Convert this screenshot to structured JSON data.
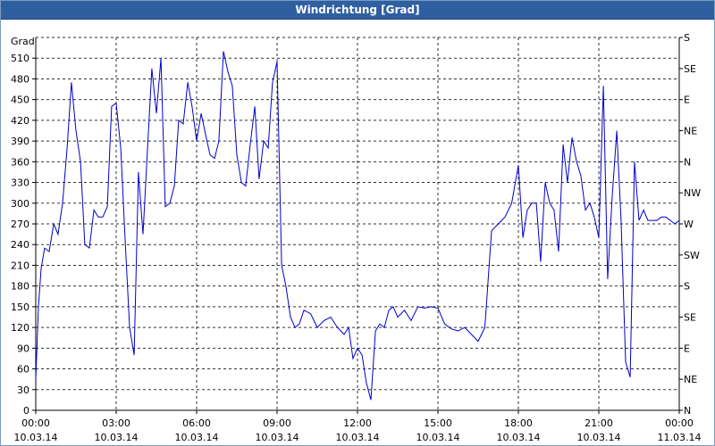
{
  "window": {
    "title": "Windrichtung [Grad]"
  },
  "chart_data": {
    "type": "line",
    "title": "Windrichtung [Grad]",
    "ylabel": "Grad",
    "ylim": [
      0,
      540
    ],
    "y_ticks": [
      0,
      30,
      60,
      90,
      120,
      150,
      180,
      210,
      240,
      270,
      300,
      330,
      360,
      390,
      420,
      450,
      480,
      510
    ],
    "y2_labels": [
      "N",
      "NE",
      "E",
      "SE",
      "S",
      "SW",
      "W",
      "NW",
      "N",
      "NE",
      "E",
      "SE",
      "S"
    ],
    "x_range_hours": [
      0,
      24
    ],
    "x_ticks": [
      {
        "t": 0,
        "time": "00:00",
        "date": "10.03.14"
      },
      {
        "t": 3,
        "time": "03:00",
        "date": "10.03.14"
      },
      {
        "t": 6,
        "time": "06:00",
        "date": "10.03.14"
      },
      {
        "t": 9,
        "time": "09:00",
        "date": "10.03.14"
      },
      {
        "t": 12,
        "time": "12:00",
        "date": "10.03.14"
      },
      {
        "t": 15,
        "time": "15:00",
        "date": "10.03.14"
      },
      {
        "t": 18,
        "time": "18:00",
        "date": "10.03.14"
      },
      {
        "t": 21,
        "time": "21:00",
        "date": "10.03.14"
      },
      {
        "t": 24,
        "time": "00:00",
        "date": "11.03.14"
      }
    ],
    "grid": true,
    "colors": {
      "series": "#0000cc",
      "titlebar": "#2f5fa0"
    },
    "series": [
      {
        "x": [
          0.0,
          0.1,
          0.2,
          0.33,
          0.5,
          0.67,
          0.83,
          1.0,
          1.17,
          1.33,
          1.5,
          1.67,
          1.83,
          2.0,
          2.17,
          2.33,
          2.5,
          2.67,
          2.83,
          3.0,
          3.17,
          3.33,
          3.5,
          3.67,
          3.83,
          4.0,
          4.17,
          4.33,
          4.5,
          4.67,
          4.83,
          5.0,
          5.17,
          5.33,
          5.5,
          5.67,
          5.83,
          6.0,
          6.17,
          6.33,
          6.5,
          6.67,
          6.83,
          7.0,
          7.17,
          7.33,
          7.5,
          7.67,
          7.83,
          8.0,
          8.17,
          8.33,
          8.5,
          8.67,
          8.83,
          9.0,
          9.17,
          9.33,
          9.5,
          9.67,
          9.83,
          10.0,
          10.25,
          10.5,
          10.75,
          11.0,
          11.25,
          11.5,
          11.67,
          11.83,
          12.0,
          12.17,
          12.33,
          12.5,
          12.67,
          12.83,
          13.0,
          13.17,
          13.33,
          13.5,
          13.75,
          14.0,
          14.25,
          14.5,
          14.75,
          15.0,
          15.25,
          15.5,
          15.75,
          16.0,
          16.25,
          16.5,
          16.75,
          17.0,
          17.25,
          17.5,
          17.75,
          18.0,
          18.17,
          18.33,
          18.5,
          18.67,
          18.83,
          19.0,
          19.17,
          19.33,
          19.5,
          19.67,
          19.83,
          20.0,
          20.17,
          20.33,
          20.5,
          20.67,
          20.83,
          21.0,
          21.17,
          21.33,
          21.5,
          21.67,
          21.83,
          22.0,
          22.17,
          22.33,
          22.5,
          22.67,
          22.83,
          23.0,
          23.17,
          23.33,
          23.5,
          23.67,
          23.83,
          24.0
        ],
        "y": [
          45,
          150,
          205,
          235,
          230,
          270,
          255,
          300,
          380,
          475,
          405,
          360,
          240,
          235,
          290,
          280,
          280,
          295,
          440,
          445,
          380,
          250,
          120,
          80,
          345,
          255,
          380,
          495,
          430,
          510,
          295,
          300,
          325,
          420,
          415,
          475,
          440,
          390,
          430,
          400,
          370,
          365,
          390,
          520,
          490,
          470,
          370,
          330,
          325,
          385,
          440,
          335,
          390,
          380,
          475,
          505,
          210,
          180,
          135,
          120,
          125,
          145,
          140,
          120,
          130,
          135,
          120,
          110,
          120,
          75,
          90,
          80,
          40,
          15,
          115,
          125,
          120,
          145,
          150,
          135,
          145,
          130,
          150,
          148,
          150,
          148,
          125,
          118,
          115,
          120,
          110,
          100,
          120,
          260,
          270,
          280,
          300,
          355,
          250,
          290,
          300,
          300,
          215,
          330,
          300,
          290,
          230,
          385,
          330,
          395,
          360,
          340,
          290,
          300,
          280,
          250,
          470,
          190,
          310,
          405,
          275,
          70,
          48,
          360,
          275,
          290,
          275,
          275,
          275,
          280,
          280,
          275,
          270,
          275
        ]
      }
    ]
  }
}
